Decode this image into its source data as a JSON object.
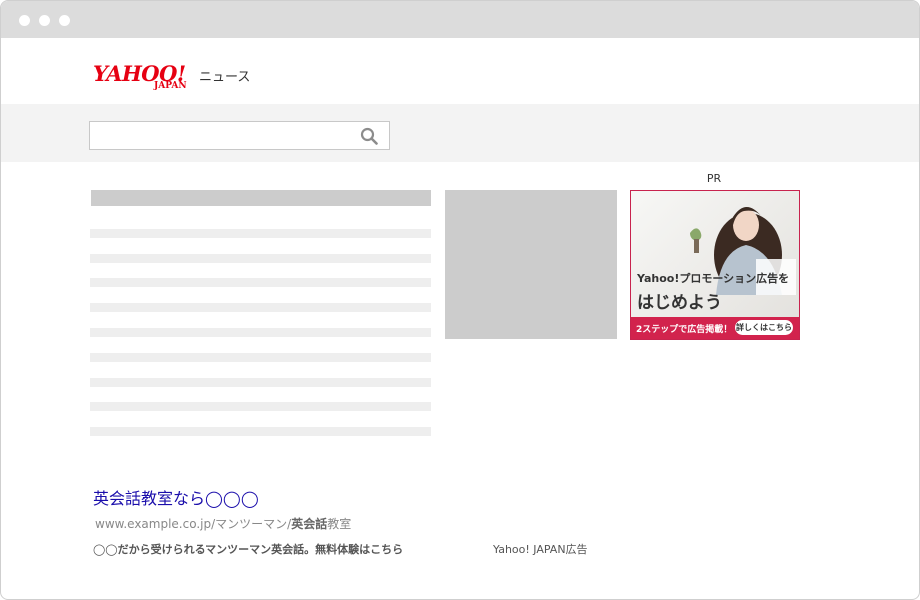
{
  "window": {
    "controls": [
      "window-dot-1",
      "window-dot-2",
      "window-dot-3"
    ]
  },
  "header": {
    "logo_main": "YAHOO!",
    "logo_sub": "JAPAN",
    "logo_service": "ニュース",
    "brand_color": "#e60012"
  },
  "search": {
    "value": "",
    "placeholder": "",
    "icon": "search-icon"
  },
  "banner_ad": {
    "label": "PR",
    "line1": "Yahoo!プロモーション広告を",
    "line2": "はじめよう",
    "footer_text": "2ステップで広告掲載！",
    "cta": "詳しくはこちら",
    "accent_color": "#d2234d"
  },
  "text_ad": {
    "headline": "英会話教室なら◯◯◯",
    "url_prefix": "www.example.co.jp/マンツーマン/",
    "url_bold": "英会話",
    "url_suffix": "教室",
    "description": "◯◯だから受けられるマンツーマン英会話。無料体験はこちら",
    "sponsor": "Yahoo! JAPAN広告"
  }
}
